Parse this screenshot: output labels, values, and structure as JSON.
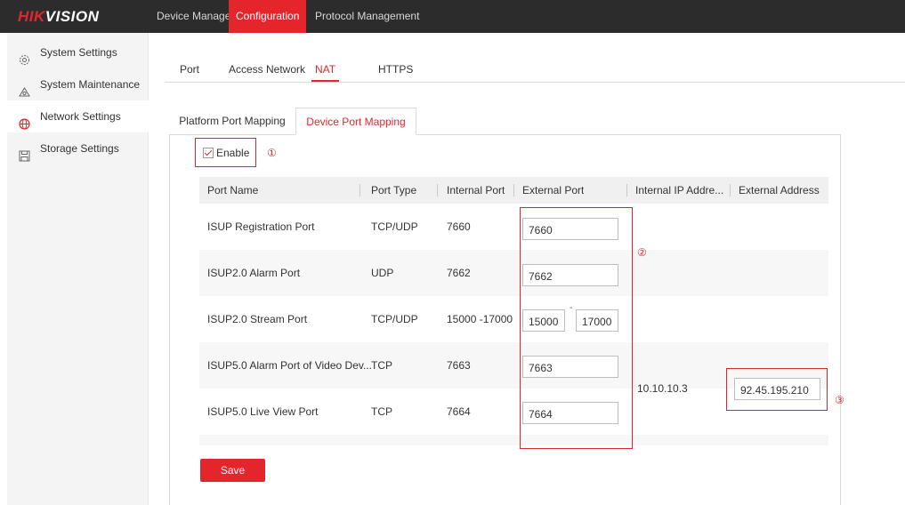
{
  "header": {
    "logo_prefix": "HIK",
    "logo_suffix": "VISION",
    "nav": [
      {
        "label": "Device Management",
        "active": false
      },
      {
        "label": "Configuration",
        "active": true
      },
      {
        "label": "Protocol Management",
        "active": false
      }
    ]
  },
  "sidebar": {
    "items": [
      {
        "label": "System Settings",
        "icon": "gear-icon",
        "active": false
      },
      {
        "label": "System Maintenance",
        "icon": "tools-icon",
        "active": false
      },
      {
        "label": "Network Settings",
        "icon": "globe-icon",
        "active": true
      },
      {
        "label": "Storage Settings",
        "icon": "disk-icon",
        "active": false
      }
    ]
  },
  "subtabs": [
    "Port",
    "Access Network",
    "NAT",
    "HTTPS"
  ],
  "active_subtab": "NAT",
  "mapping_tabs": [
    "Platform Port Mapping",
    "Device Port Mapping"
  ],
  "active_mapping_tab": "Device Port Mapping",
  "enable": {
    "label": "Enable",
    "checked": true
  },
  "annotations": {
    "one": "①",
    "two": "②",
    "three": "③"
  },
  "table": {
    "columns": [
      "Port Name",
      "Port Type",
      "Internal Port",
      "External Port",
      "Internal IP Addre...",
      "External Address"
    ],
    "rows": [
      {
        "name": "ISUP Registration Port",
        "type": "TCP/UDP",
        "internal": "7660",
        "external": "7660"
      },
      {
        "name": "ISUP2.0 Alarm Port",
        "type": "UDP",
        "internal": "7662",
        "external": "7662"
      },
      {
        "name": "ISUP2.0 Stream Port",
        "type": "TCP/UDP",
        "internal": "15000 -17000",
        "external_start": "15000",
        "range_sep": "-",
        "external_end": "17000"
      },
      {
        "name": "ISUP5.0 Alarm Port of Video Dev...",
        "type": "TCP",
        "internal": "7663",
        "external": "7663"
      },
      {
        "name": "ISUP5.0 Live View Port",
        "type": "TCP",
        "internal": "7664",
        "external": "7664"
      }
    ],
    "internal_ip": "10.10.10.3",
    "external_address": "92.45.195.210"
  },
  "save_label": "Save",
  "colors": {
    "accent": "#e4262c",
    "topbar": "#2c2c2c",
    "sidebar": "#f4f4f4"
  }
}
